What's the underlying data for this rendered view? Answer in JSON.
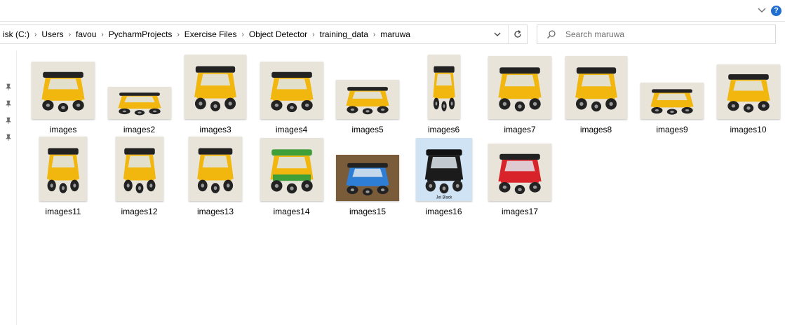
{
  "ribbon": {
    "help_label": "?"
  },
  "address": {
    "crumbs": [
      "isk (C:)",
      "Users",
      "favou",
      "PycharmProjects",
      "Exercise Files",
      "Object Detector",
      "training_data",
      "maruwa"
    ]
  },
  "search": {
    "placeholder": "Search maruwa"
  },
  "files": [
    {
      "name": "images",
      "shows": "yellow"
    },
    {
      "name": "images2",
      "shows": "yellow"
    },
    {
      "name": "images3",
      "shows": "yellow"
    },
    {
      "name": "images4",
      "shows": "yellow"
    },
    {
      "name": "images5",
      "shows": "yellow"
    },
    {
      "name": "images6",
      "shows": "yellow"
    },
    {
      "name": "images7",
      "shows": "yellow"
    },
    {
      "name": "images8",
      "shows": "yellow"
    },
    {
      "name": "images9",
      "shows": "yellow"
    },
    {
      "name": "images10",
      "shows": "yellow"
    },
    {
      "name": "images11",
      "shows": "yellow"
    },
    {
      "name": "images12",
      "shows": "yellow"
    },
    {
      "name": "images13",
      "shows": "yellow"
    },
    {
      "name": "images14",
      "shows": "green-yellow"
    },
    {
      "name": "images15",
      "shows": "blue"
    },
    {
      "name": "images16",
      "shows": "black",
      "overlay_text": "Jet Black"
    },
    {
      "name": "images17",
      "shows": "red"
    }
  ],
  "colors": {
    "yellow": "#f2b70f",
    "green": "#3fa03a",
    "blue": "#2f7ed6",
    "black": "#1b1b1b",
    "red": "#d9232a",
    "accent": "#1e6fd0"
  }
}
